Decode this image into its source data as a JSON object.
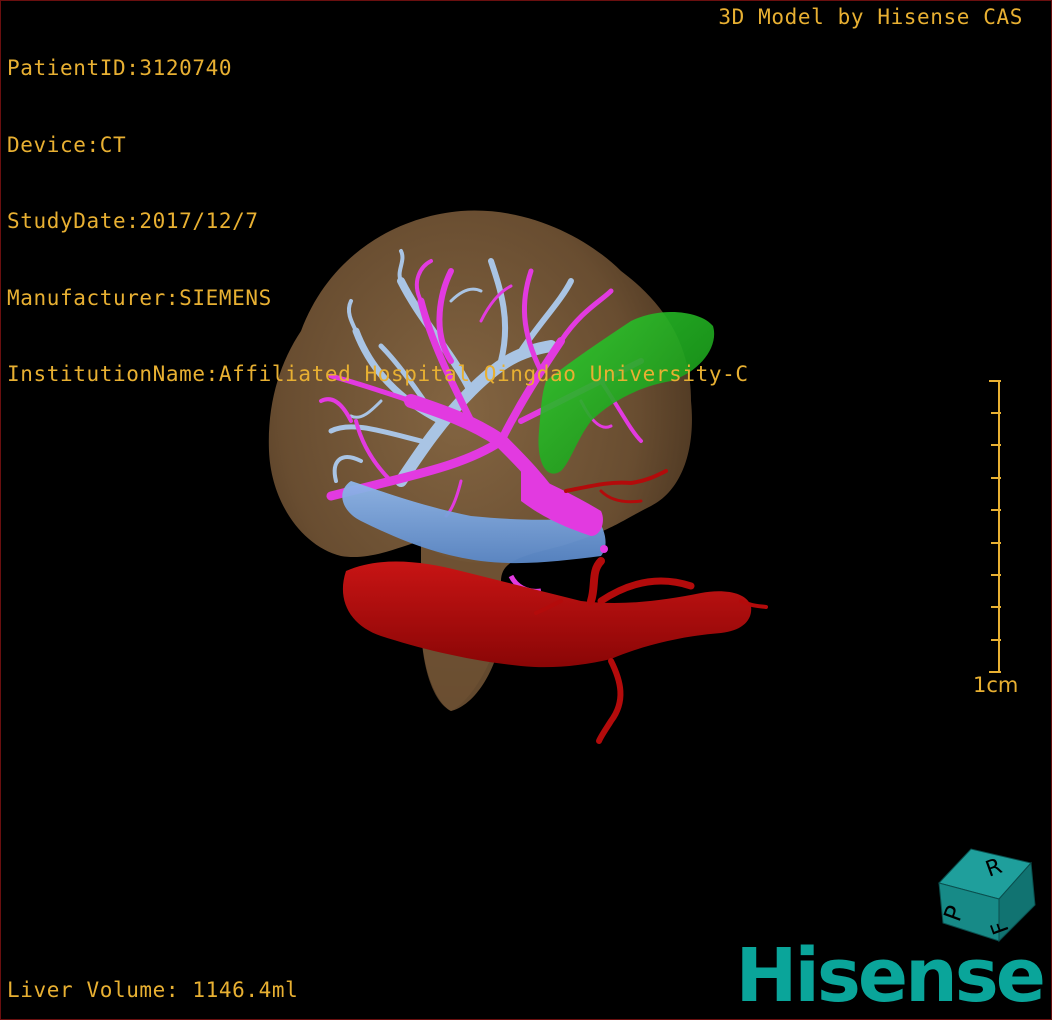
{
  "dicom_info": {
    "patient_id": "PatientID:3120740",
    "device": "Device:CT",
    "study_date": "StudyDate:2017/12/7",
    "manufacturer": "Manufacturer:SIEMENS",
    "institution": "InstitutionName:Affiliated Hospital Qingdao University-C"
  },
  "credit": "3D Model by Hisense CAS",
  "liver_volume": "Liver Volume: 1146.4ml",
  "scale": {
    "label": "1cm"
  },
  "orientation_cube": {
    "letters": [
      "P",
      "R",
      "F"
    ],
    "color": "#1a8c8a"
  },
  "logo": "Hisense",
  "colors": {
    "overlay_text": "#e8b032",
    "liver": "#7a5a38",
    "portal_vein": "#e23ae0",
    "hepatic_vein": "#a9c4e4",
    "inferior_vena_cava": "#6ea0de",
    "hepatic_artery_aorta": "#b30b0b",
    "gallbladder": "#22b322",
    "logo": "#0aa59a",
    "viewport_border": "#6a0f0f"
  }
}
